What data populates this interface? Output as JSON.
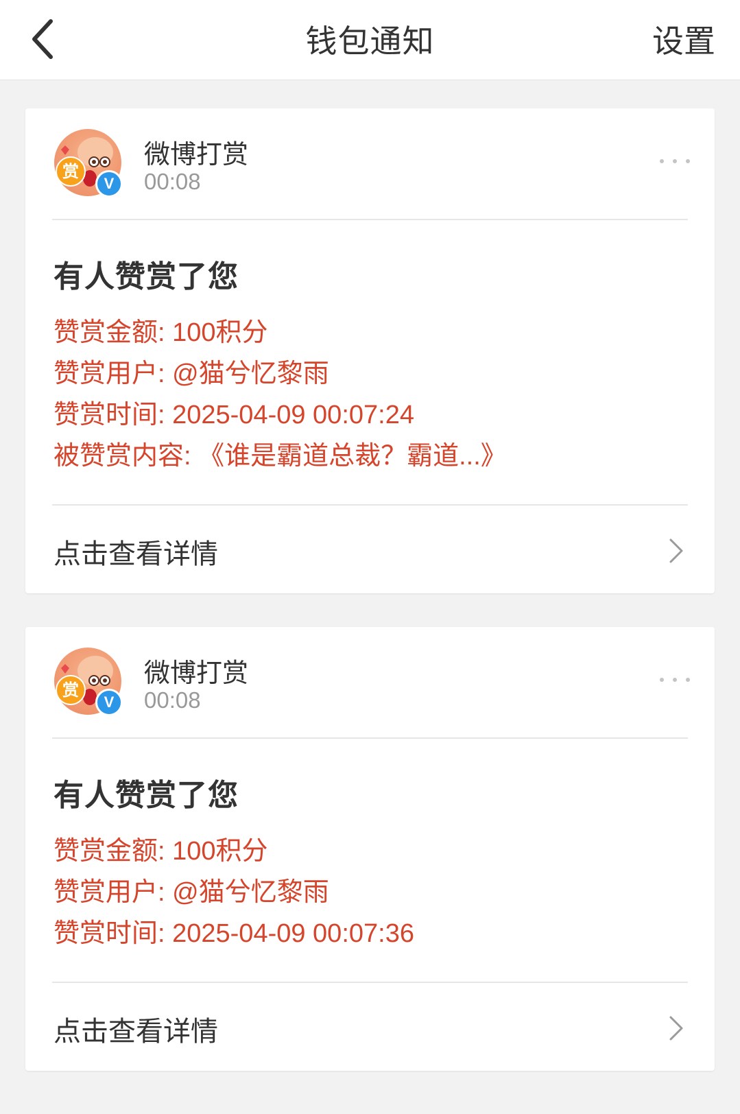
{
  "header": {
    "title": "钱包通知",
    "settings_label": "设置"
  },
  "notifications": [
    {
      "sender": "微博打赏",
      "time": "00:08",
      "badge_text": "赏",
      "verify_text": "V",
      "title": "有人赞赏了您",
      "details": [
        "赞赏金额: 100积分",
        "赞赏用户: @猫兮忆黎雨",
        "赞赏时间: 2025-04-09 00:07:24",
        "被赞赏内容: 《谁是霸道总裁？霸道...》"
      ],
      "action_label": "点击查看详情"
    },
    {
      "sender": "微博打赏",
      "time": "00:08",
      "badge_text": "赏",
      "verify_text": "V",
      "title": "有人赞赏了您",
      "details": [
        "赞赏金额: 100积分",
        "赞赏用户: @猫兮忆黎雨",
        "赞赏时间: 2025-04-09 00:07:36"
      ],
      "action_label": "点击查看详情"
    }
  ],
  "colors": {
    "accent_red": "#d5452c",
    "verify_blue": "#2c96e8",
    "badge_orange": "#f7a21a"
  },
  "icons": {
    "back": "back-arrow-icon",
    "more": "more-dots-icon",
    "chevron": "chevron-right-icon"
  }
}
